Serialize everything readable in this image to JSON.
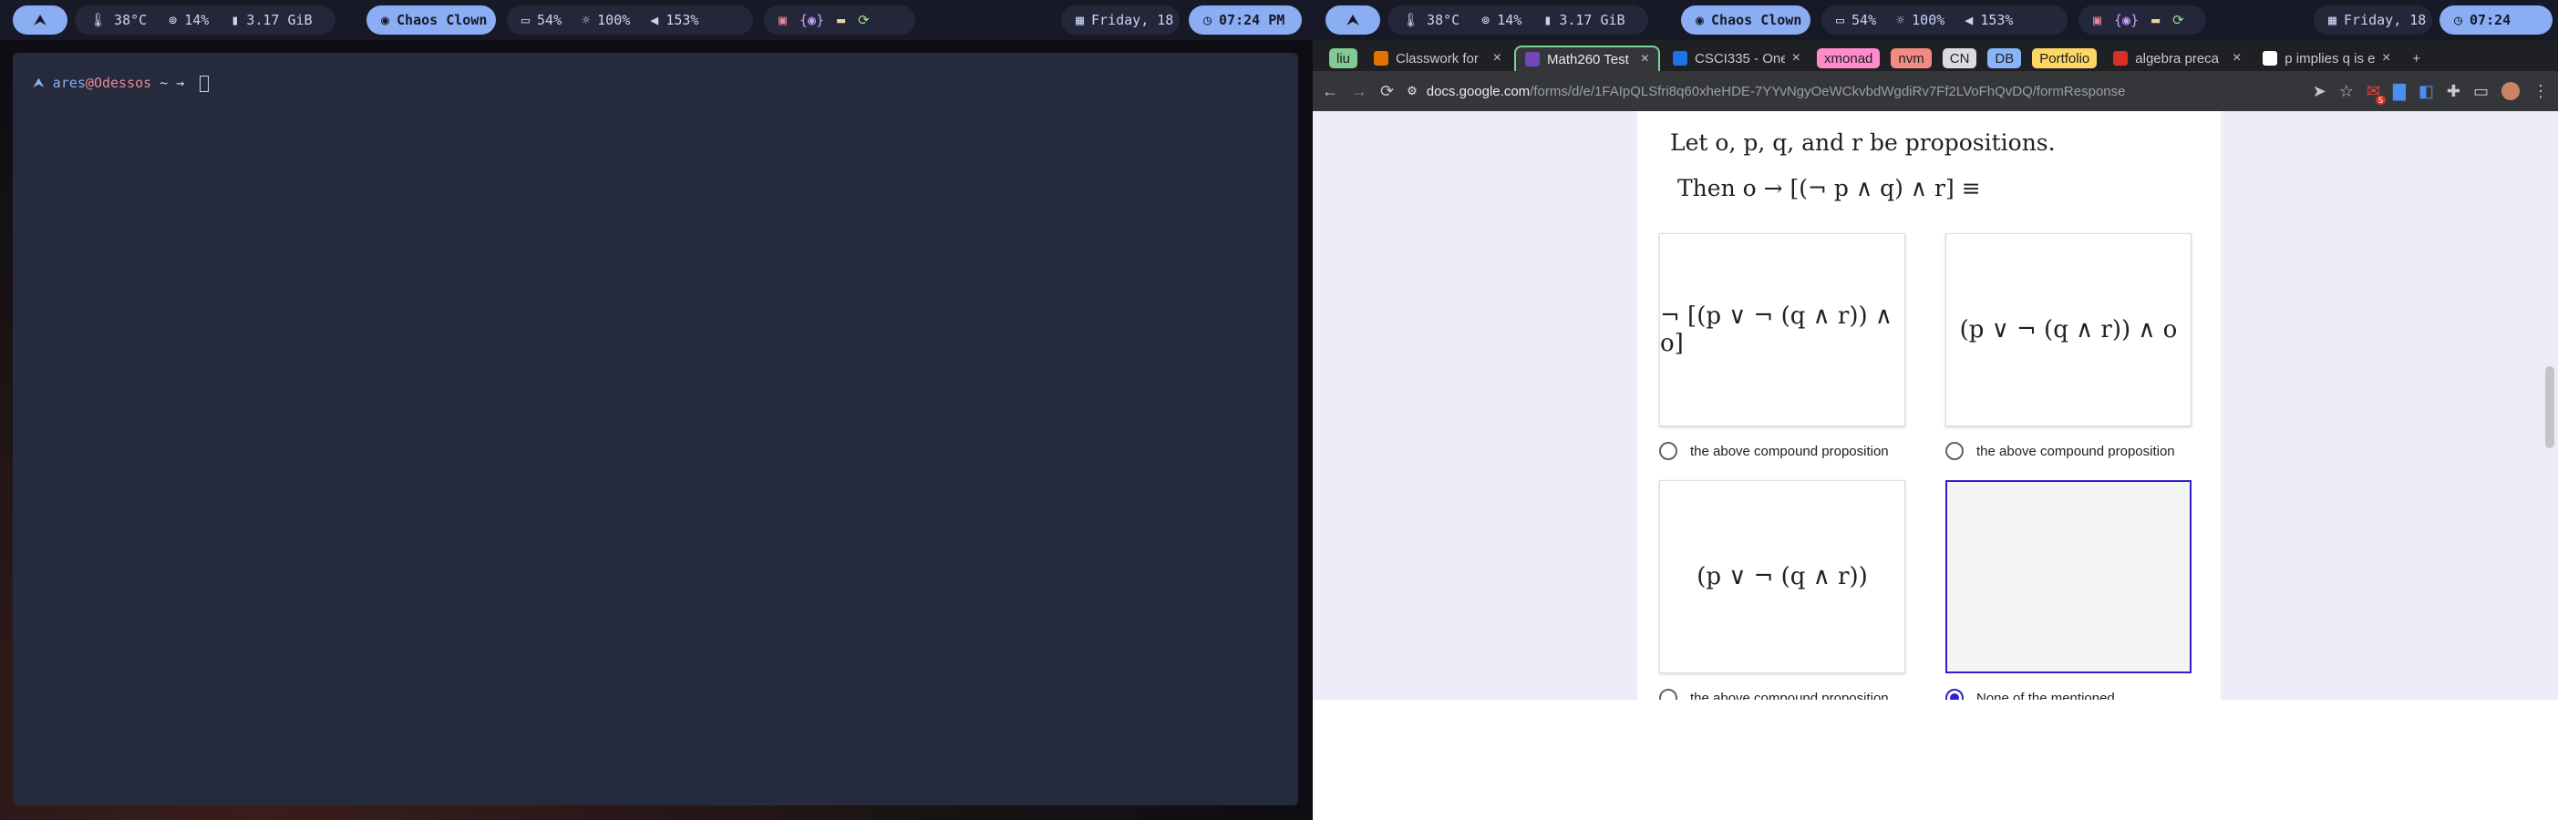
{
  "left_bar": {
    "temp": "38°C",
    "cpu": "14%",
    "mem": "3.17 GiB",
    "wifi": "Chaos Clown",
    "battery": "54%",
    "brightness": "100%",
    "volume": "153%",
    "date": "Friday, 18",
    "time": "07:24 PM"
  },
  "right_bar": {
    "temp": "38°C",
    "cpu": "14%",
    "mem": "3.17 GiB",
    "wifi": "Chaos Clown",
    "battery": "54%",
    "brightness": "100%",
    "volume": "153%",
    "date": "Friday, 18",
    "time": "07:24"
  },
  "terminal": {
    "user": "ares",
    "at": "@",
    "host": "Odessos",
    "prompt": "~ →"
  },
  "browser": {
    "tabs": [
      {
        "kind": "group",
        "label": "liu",
        "color": "#81c995",
        "text": "#1f2023"
      },
      {
        "kind": "tab",
        "label": "Classwork for",
        "favicon": "#e37400"
      },
      {
        "kind": "tab",
        "label": "Math260 Test",
        "favicon": "#7248b9",
        "active": true
      },
      {
        "kind": "tab",
        "label": "CSCI335 - One",
        "favicon": "#1a73e8"
      },
      {
        "kind": "group",
        "label": "xmonad",
        "color": "#ff8bcb",
        "text": "#1f2023"
      },
      {
        "kind": "group",
        "label": "nvm",
        "color": "#f28b82",
        "text": "#1f2023"
      },
      {
        "kind": "group",
        "label": "CN",
        "color": "#dadce0",
        "text": "#1f2023"
      },
      {
        "kind": "group",
        "label": "DB",
        "color": "#8ab4f8",
        "text": "#1f2023"
      },
      {
        "kind": "group",
        "label": "Portfolio",
        "color": "#fdd663",
        "text": "#1f2023"
      },
      {
        "kind": "tab",
        "label": "algebra preca",
        "favicon": "#d93025"
      },
      {
        "kind": "tab",
        "label": "p implies q is e",
        "favicon": "#ffffff"
      }
    ],
    "url_host": "docs.google.com",
    "url_path": "/forms/d/e/1FAIpQLSfri8q60xheHDE-7YYvNgyOeWCkvbdWgdiRv7Ff2LVoFhQvDQ/formResponse",
    "extension_badge": "5"
  },
  "form": {
    "question_line1": "Let o, p, q, and r be propositions.",
    "question_line2": "Then o → [(¬ p ∧ q) ∧ r] ≡",
    "options": [
      {
        "expr": "¬ [(p ∨ ¬ (q ∧ r)) ∧ o]",
        "label": "the above compound proposition",
        "selected": false
      },
      {
        "expr": "(p ∨ ¬ (q ∧ r)) ∧ o",
        "label": "the above compound proposition",
        "selected": false
      },
      {
        "expr": "(p ∨ ¬ (q ∧ r))",
        "label": "the above compound proposition",
        "selected": false
      },
      {
        "expr": "",
        "label": "None of the mentioned",
        "selected": true
      }
    ]
  }
}
